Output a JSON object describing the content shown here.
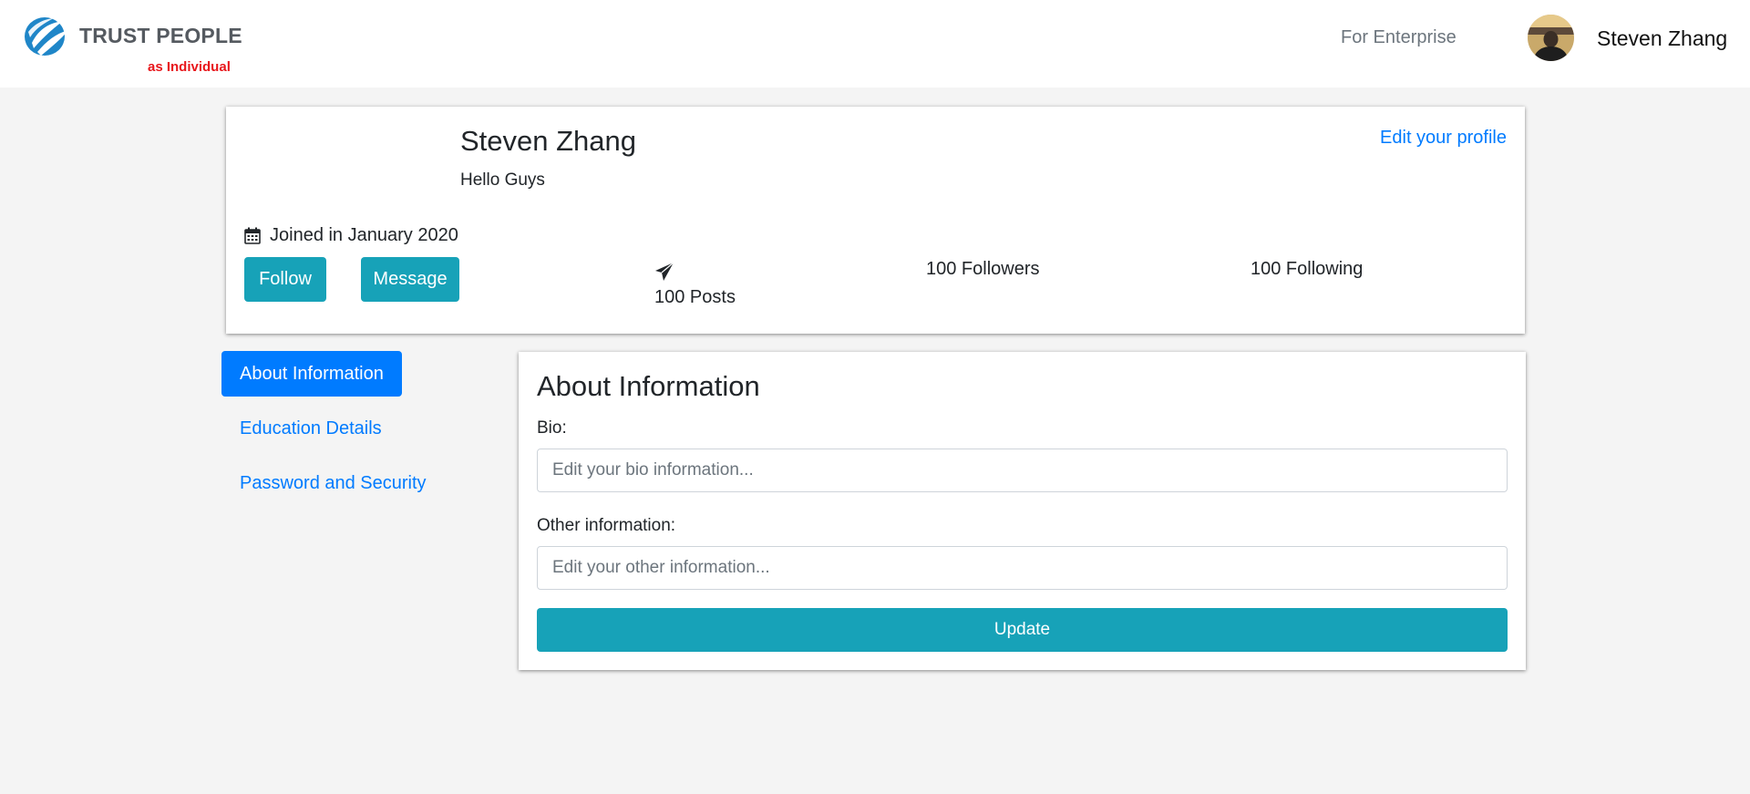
{
  "header": {
    "logo_text": "TRUST PEOPLE",
    "logo_subtitle": "as Individual",
    "nav_enterprise": "For Enterprise",
    "username": "Steven Zhang"
  },
  "profile": {
    "name": "Steven Zhang",
    "bio": "Hello Guys",
    "edit_link": "Edit your profile",
    "joined": "Joined in January 2020",
    "follow_label": "Follow",
    "message_label": "Message",
    "posts": "100 Posts",
    "followers": "100 Followers",
    "following": "100 Following"
  },
  "sidenav": {
    "items": [
      {
        "label": "About Information",
        "active": true
      },
      {
        "label": "Education Details",
        "active": false
      },
      {
        "label": "Password and Security",
        "active": false
      }
    ]
  },
  "content": {
    "title": "About Information",
    "bio_label": "Bio:",
    "bio_placeholder": "Edit your bio information...",
    "other_label": "Other information:",
    "other_placeholder": "Edit your other information...",
    "update_label": "Update"
  },
  "colors": {
    "primary": "#007bff",
    "teal": "#17a2b8",
    "logo_red": "#e8161b",
    "background": "#f4f4f4"
  },
  "icons": {
    "logo": "trust-people-logo-icon",
    "calendar": "calendar-icon",
    "posts": "paper-plane-icon",
    "avatar": "user-avatar"
  }
}
